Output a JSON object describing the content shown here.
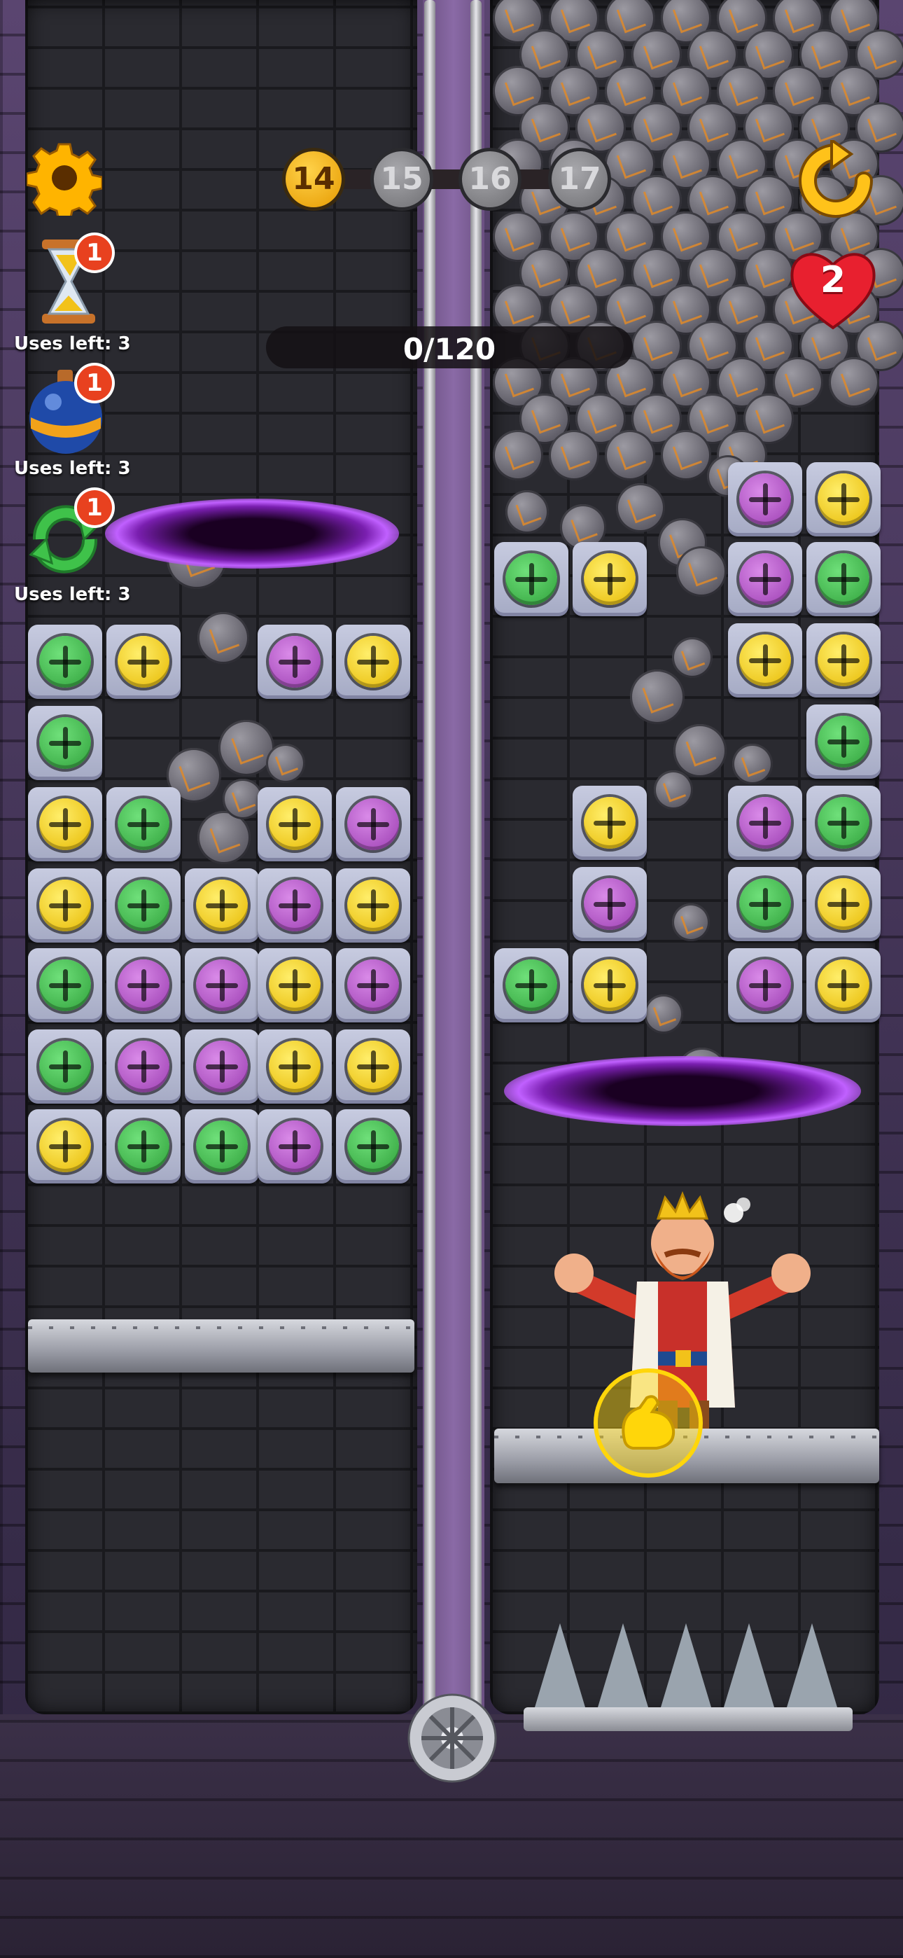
{
  "hud": {
    "levels": [
      {
        "label": "14",
        "state": "current"
      },
      {
        "label": "15",
        "state": "locked"
      },
      {
        "label": "16",
        "state": "locked"
      },
      {
        "label": "17",
        "state": "locked"
      }
    ],
    "progress_text": "0/120",
    "lives": "2",
    "settings_icon": "gear-icon",
    "restart_icon": "restart-icon"
  },
  "powerups": [
    {
      "name": "hourglass",
      "icon": "hourglass-icon",
      "badge": "1",
      "uses_text": "Uses left: 3"
    },
    {
      "name": "bomb",
      "icon": "bomb-icon",
      "badge": "1",
      "uses_text": "Uses left: 3"
    },
    {
      "name": "shuffle",
      "icon": "shuffle-icon",
      "badge": "1",
      "uses_text": "Uses left: 3"
    }
  ],
  "colors": {
    "green": "#2fa03a",
    "yellow": "#e6b800",
    "purple": "#9a3cb0",
    "heart": "#e8202f",
    "gold": "#ffc21a"
  },
  "character": {
    "icon": "king-icon",
    "strength_icon": "flexed-arm-icon"
  }
}
